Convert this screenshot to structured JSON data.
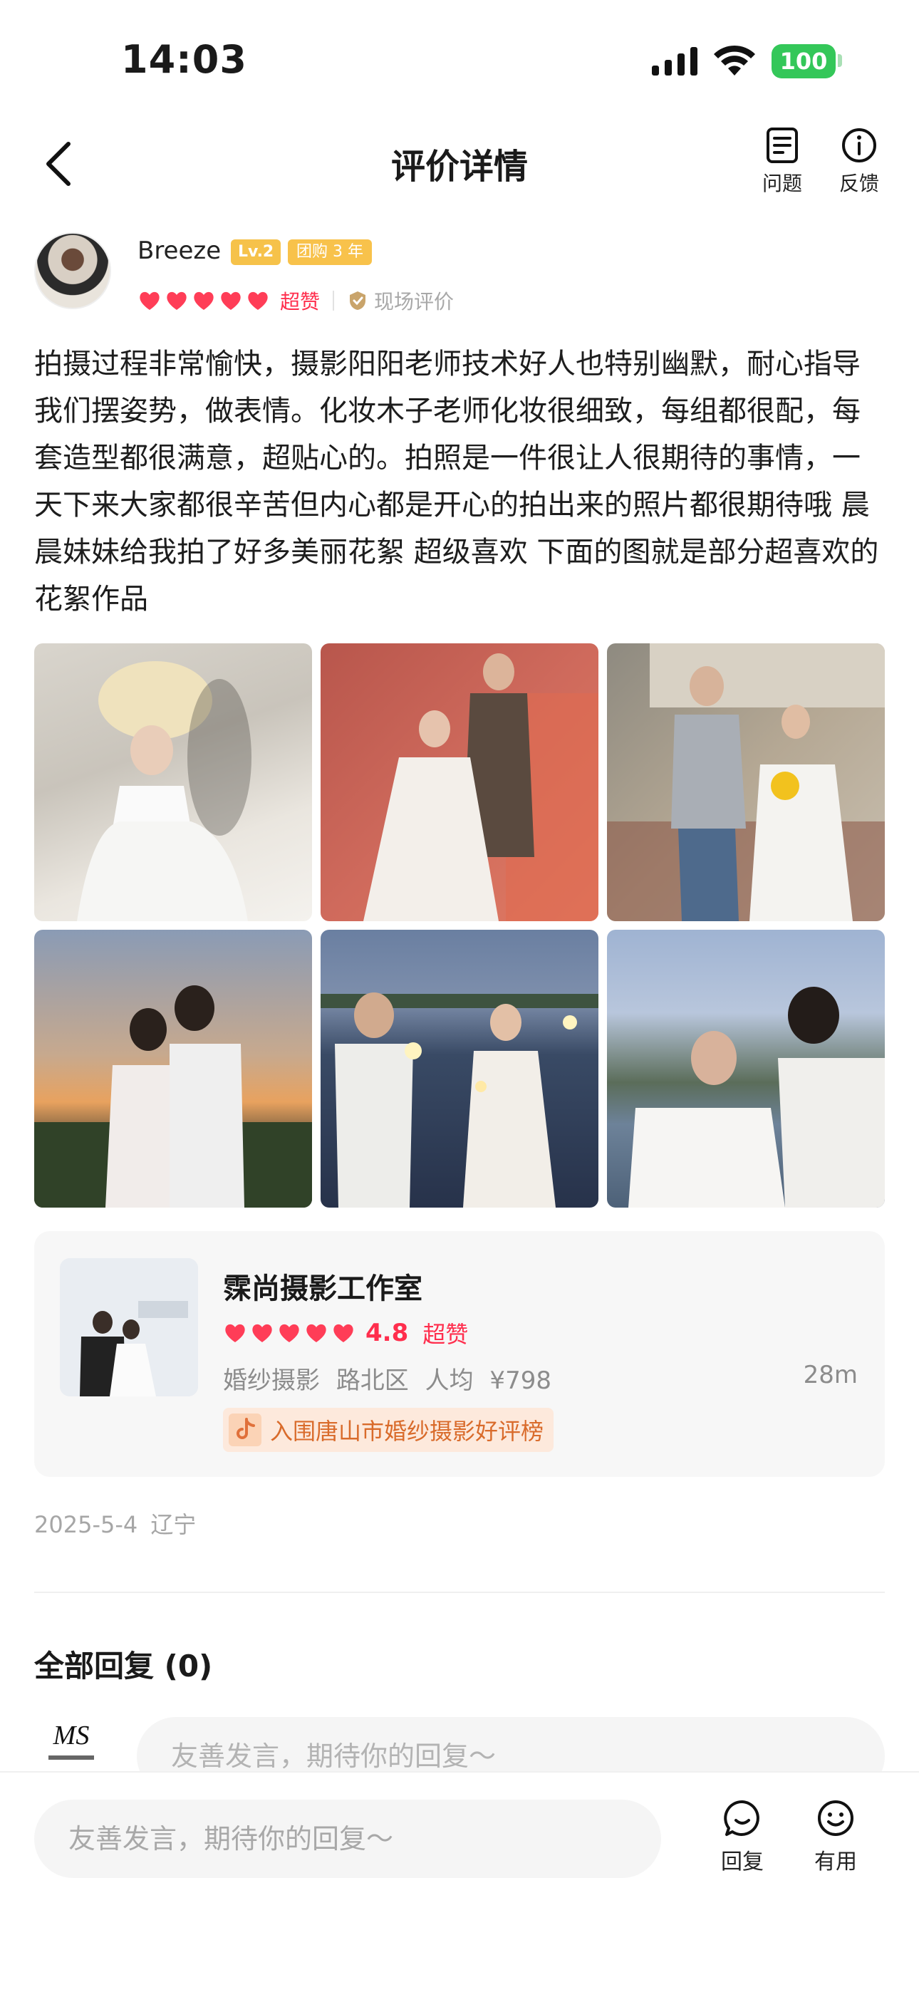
{
  "status_bar": {
    "time": "14:03",
    "battery": "100"
  },
  "nav": {
    "title": "评价详情",
    "question_label": "问题",
    "feedback_label": "反馈"
  },
  "author": {
    "name": "Breeze",
    "level": "Lv.2",
    "years_badge": "团购 3 年",
    "hearts": 5,
    "rating_word": "超赞",
    "review_type": "现场评价"
  },
  "review": {
    "text": "拍摄过程非常愉快，摄影阳阳老师技术好人也特别幽默，耐心指导我们摆姿势，做表情。化妆木子老师化妆很细致，每组都很配，每套造型都很满意，超贴心的。拍照是一件很让人很期待的事情，一天下来大家都很辛苦但内心都是开心的拍出来的照片都很期待哦 晨晨妹妹给我拍了好多美丽花絮 超级喜欢 下面的图就是部分超喜欢的花絮作品"
  },
  "shop": {
    "name": "霂尚摄影工作室",
    "hearts": 5,
    "score": "4.8",
    "rating_word": "超赞",
    "category": "婚纱摄影",
    "district": "路北区",
    "avg_price": "人均 ¥798",
    "distance": "28m",
    "rank_text": "入围唐山市婚纱摄影好评榜"
  },
  "meta": {
    "date": "2025-5-4",
    "location": "辽宁"
  },
  "replies": {
    "title": "全部回复 (0)",
    "placeholder": "友善发言，期待你的回复～"
  },
  "bottom_bar": {
    "placeholder": "友善发言，期待你的回复～",
    "reply_label": "回复",
    "useful_label": "有用"
  },
  "colors": {
    "accent_red": "#ff2e4d",
    "battery_green": "#34c759",
    "rank_orange": "#d96b2b"
  }
}
